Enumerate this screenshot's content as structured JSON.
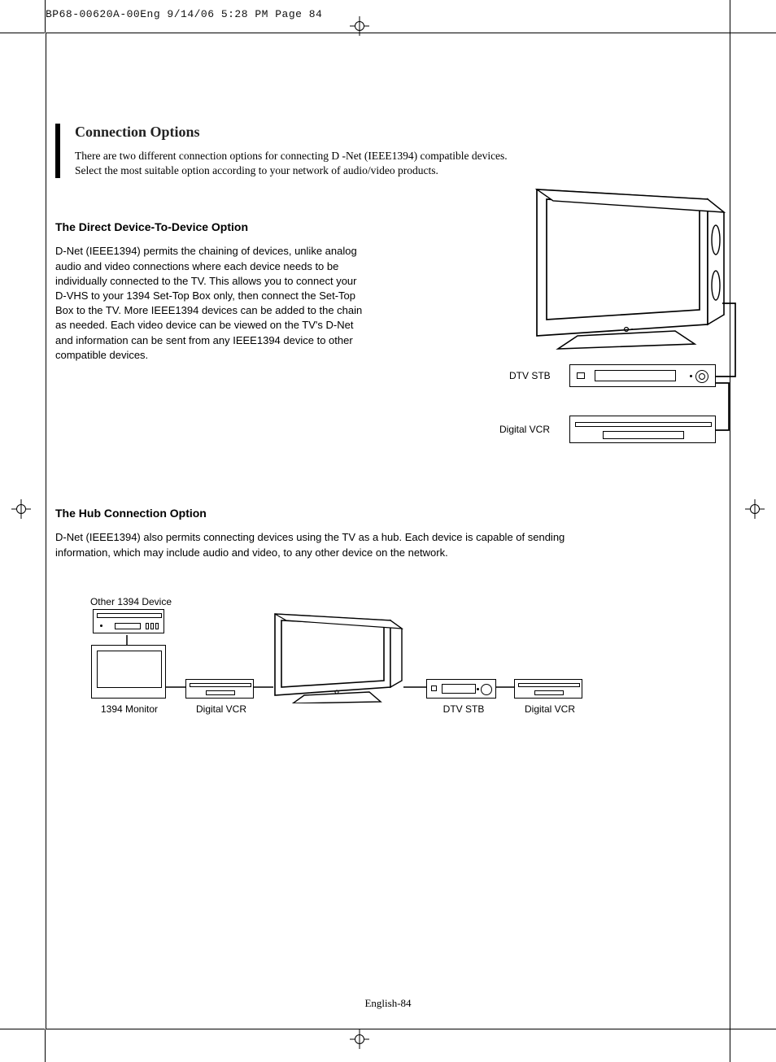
{
  "header": "BP68-00620A-00Eng  9/14/06  5:28 PM  Page 84",
  "section": {
    "title": "Connection Options",
    "intro_line1": "There are two different connection options for connecting D -Net (IEEE1394) compatible devices.",
    "intro_line2": "Select the most suitable option according to your network of audio/video products."
  },
  "opt1": {
    "heading": "The Direct Device-To-Device Option",
    "body": "D-Net (IEEE1394) permits the chaining of devices, unlike analog audio and video connections where each device needs to be individually connected to the TV. This allows you to connect your D-VHS to your 1394 Set-Top Box only, then connect the Set-Top Box to the TV. More IEEE1394 devices can be added to the chain as needed. Each video device can be viewed on the TV's D-Net and information can be sent from any IEEE1394 device to other compatible devices.",
    "label_stb": "DTV STB",
    "label_vcr": "Digital VCR"
  },
  "opt2": {
    "heading": "The Hub Connection Option",
    "body": "D-Net (IEEE1394) also permits connecting devices using the TV as a hub. Each device is capable of sending information, which may include audio and video, to any other device on the network.",
    "label_other": "Other 1394 Device",
    "label_monitor": "1394 Monitor",
    "label_vcr1": "Digital VCR",
    "label_stb": "DTV STB",
    "label_vcr2": "Digital VCR"
  },
  "footer": "English-84"
}
